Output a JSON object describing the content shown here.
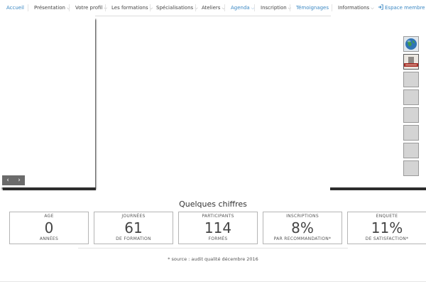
{
  "nav": {
    "items": [
      {
        "label": "Accueil",
        "dropdown": false,
        "active": true
      },
      {
        "label": "Présentation",
        "dropdown": true
      },
      {
        "label": "Votre profil",
        "dropdown": true
      },
      {
        "label": "Les formations",
        "dropdown": true
      },
      {
        "label": "Spécialisations",
        "dropdown": true
      },
      {
        "label": "Ateliers",
        "dropdown": true
      },
      {
        "label": "Agenda",
        "dropdown": true,
        "active": true
      },
      {
        "label": "Inscription",
        "dropdown": true
      },
      {
        "label": "Témoignages",
        "dropdown": false,
        "active": true
      },
      {
        "label": "Informations",
        "dropdown": true
      }
    ],
    "member_login": "Espace membre",
    "accent_color": "#3b88c3"
  },
  "slider": {
    "prev_glyph": "‹",
    "next_glyph": "›",
    "thumbnail_count": 8,
    "active_thumbnail": 1
  },
  "stats": {
    "title": "Quelques chiffres",
    "items": [
      {
        "top": "AGE",
        "value": "0",
        "bottom": "ANNÉES"
      },
      {
        "top": "JOURNÉES",
        "value": "61",
        "bottom": "DE FORMATION"
      },
      {
        "top": "PARTICIPANTS",
        "value": "114",
        "bottom": "FORMÉS"
      },
      {
        "top": "INSCRIPTIONS",
        "value": "8%",
        "bottom": "PAR RECOMMANDATION*"
      },
      {
        "top": "ENQUETE",
        "value": "11%",
        "bottom": "DE SATISFACTION*"
      }
    ],
    "source_note": "* source : audit qualité décembre 2016"
  }
}
